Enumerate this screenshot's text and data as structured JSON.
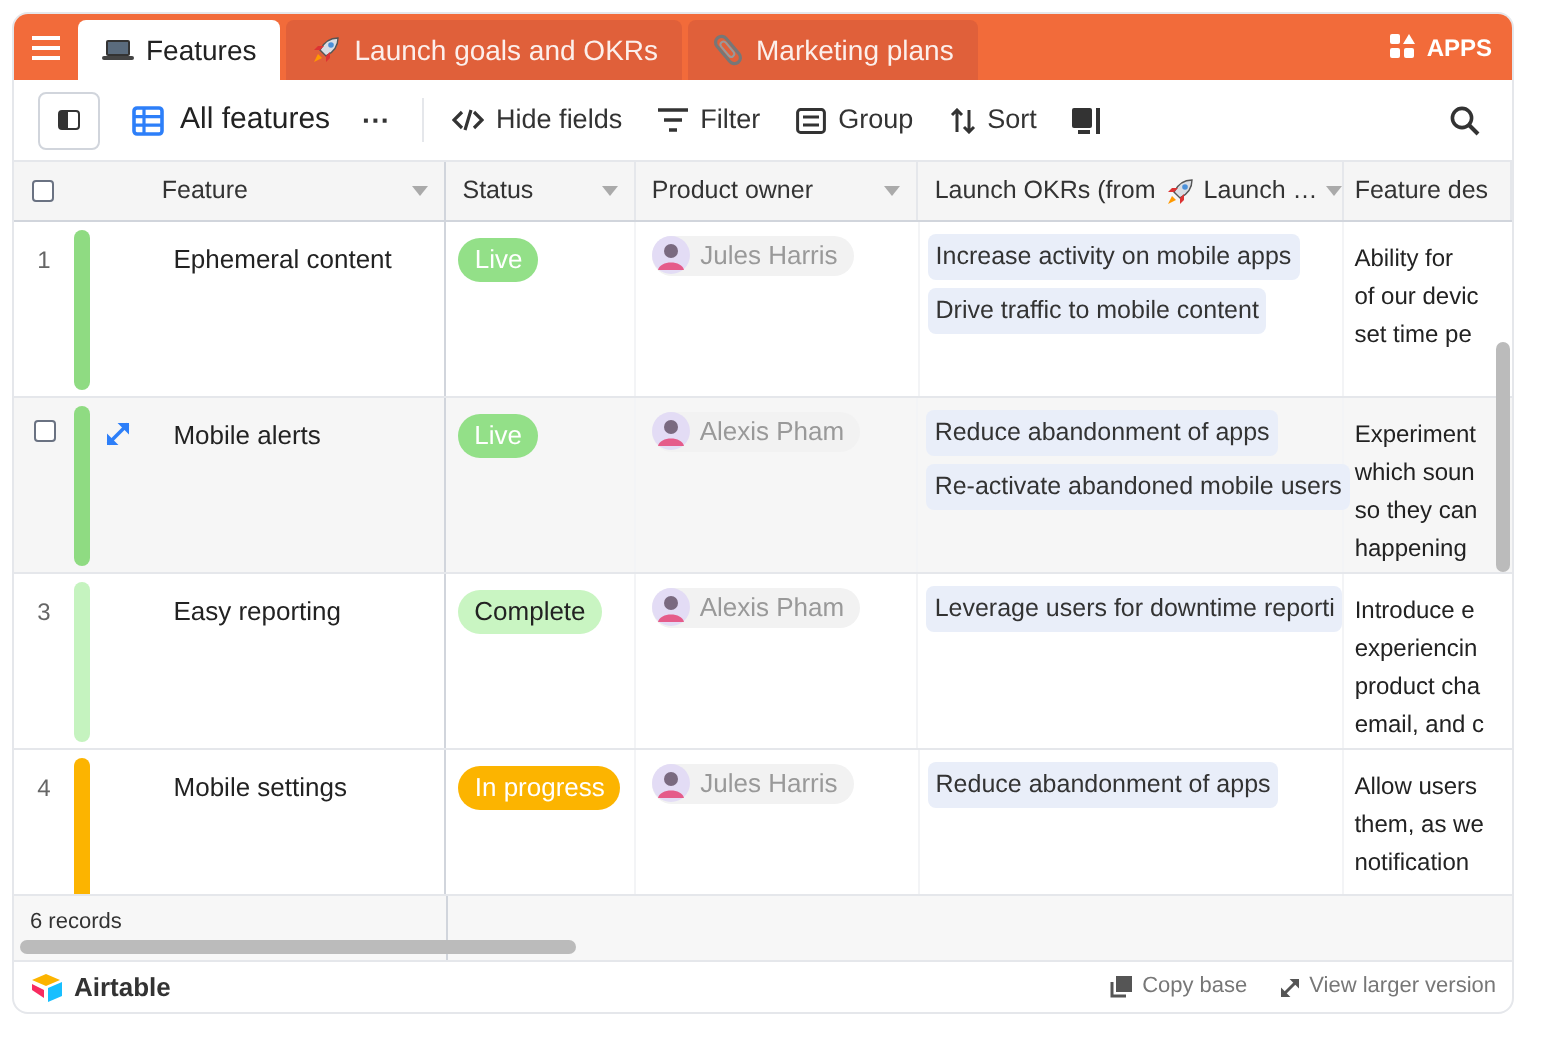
{
  "tabs": [
    {
      "kind": "laptop",
      "label": "Features",
      "selected": true
    },
    {
      "kind": "rocket",
      "label": "Launch goals and OKRs",
      "selected": false
    },
    {
      "kind": "paperclip",
      "label": "Marketing plans",
      "selected": false
    }
  ],
  "apps_button": "APPS",
  "toolbar": {
    "view_name": "All features",
    "more": "···",
    "buttons": [
      {
        "kind": "hide",
        "label": "Hide fields"
      },
      {
        "kind": "filter",
        "label": "Filter"
      },
      {
        "kind": "group",
        "label": "Group"
      },
      {
        "kind": "sort",
        "label": "Sort"
      }
    ]
  },
  "table": {
    "select_all": {
      "checked": false
    },
    "columns": [
      {
        "label": "Feature"
      },
      {
        "label": "Status"
      },
      {
        "label": "Product owner"
      },
      {
        "label": "Launch OKRs (from",
        "label_after_icon": "Launch …"
      },
      {
        "label": "Feature des"
      }
    ],
    "rows": [
      {
        "number": "1",
        "hovered": false,
        "color": "#8fdb82",
        "feature": "Ephemeral content",
        "status": {
          "label": "Live",
          "color": "#93e088"
        },
        "owner": "Jules Harris",
        "okrs": [
          "Increase activity on mobile apps",
          "Drive traffic to mobile content"
        ],
        "description": "Ability for\nof our devic\nset time pe"
      },
      {
        "hovered": true,
        "checked": false,
        "color": "#8fdb82",
        "feature": "Mobile alerts",
        "status": {
          "label": "Live",
          "color": "#93e088"
        },
        "owner": "Alexis Pham",
        "okrs": [
          "Reduce abandonment of apps",
          "Re-activate abandoned mobile users"
        ],
        "description": "Experiment\nwhich soun\nso they can\nhappening"
      },
      {
        "number": "3",
        "hovered": false,
        "color": "#c5f3bf",
        "feature": "Easy reporting",
        "status": {
          "label": "Complete",
          "color": "#c9f5c2"
        },
        "owner": "Alexis Pham",
        "okrs": [
          "Leverage users for downtime reporti"
        ],
        "description": "Introduce e\nexperiencin\nproduct cha\nemail, and c"
      },
      {
        "number": "4",
        "hovered": false,
        "color": "#fcb400",
        "feature": "Mobile settings",
        "status": {
          "label": "In progress",
          "color": "#fcb400"
        },
        "owner": "Jules Harris",
        "okrs": [
          "Reduce abandonment of apps"
        ],
        "description": "Allow users\nthem, as we\nnotification"
      }
    ],
    "record_count": "6 records"
  },
  "footer": {
    "brand": "Airtable",
    "copy": "Copy base",
    "larger": "View larger version"
  }
}
